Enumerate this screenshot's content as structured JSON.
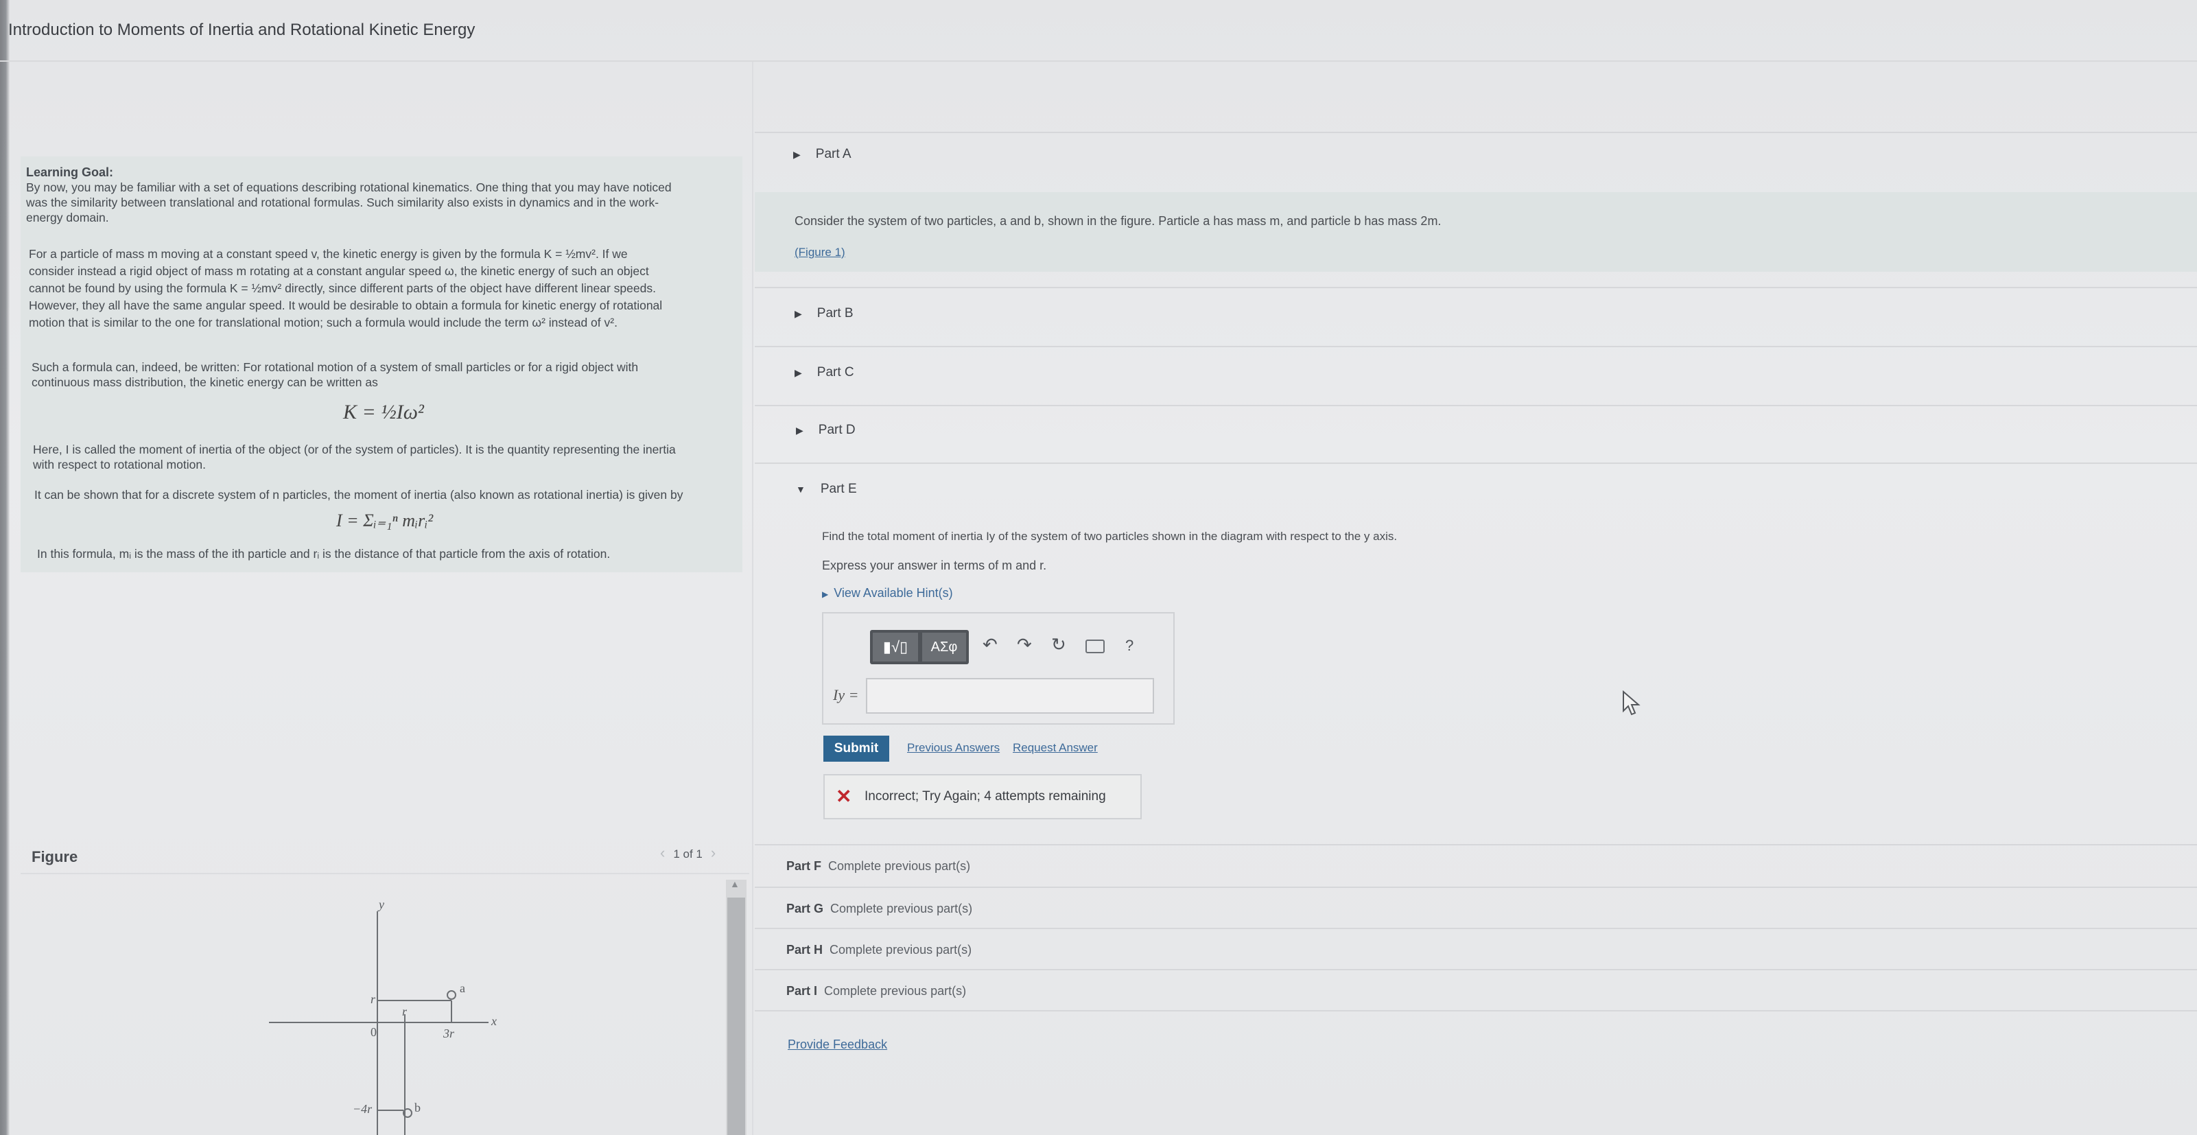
{
  "page_title": "Introduction to Moments of Inertia and Rotational Kinetic Energy",
  "learning_goal": {
    "heading": "Learning Goal:",
    "p1": [
      "By now, you may be familiar with a set of equations describing rotational kinematics. One thing that you may have noticed",
      "was the similarity between translational and rotational formulas. Such similarity also exists in dynamics and in the work-",
      "energy domain."
    ],
    "p2": [
      "For a particle of mass m moving at a constant speed v, the kinetic energy is given by the formula K = ½mv². If we",
      "consider instead a rigid object of mass m rotating at a constant angular speed ω, the kinetic energy of such an object",
      "cannot be found by using the formula K = ½mv² directly, since different parts of the object have different linear speeds.",
      "However, they all have the same angular speed. It would be desirable to obtain a formula for kinetic energy of rotational",
      "motion that is similar to the one for translational motion; such a formula would include the term ω² instead of v²."
    ],
    "p3": [
      "Such a formula can, indeed, be written: For rotational motion of a system of small particles or for a rigid object with",
      "continuous mass distribution, the kinetic energy can be written as"
    ],
    "eq1": "K = ½Iω²",
    "p4": [
      "Here, I is called the moment of inertia of the object (or of the system of particles). It is the quantity representing the inertia",
      "with respect to rotational motion."
    ],
    "p5": "It can be shown that for a discrete system of n particles, the moment of inertia (also known as rotational inertia) is given by",
    "eq2": "I = Σᵢ₌₁ⁿ mᵢrᵢ²",
    "p6": "In this formula, mᵢ is the mass of the ith particle and rᵢ is the distance of that particle from the axis of rotation."
  },
  "figure": {
    "label": "Figure",
    "pager": "1 of 1",
    "labels": {
      "y": "y",
      "x": "x",
      "r_axis": "r",
      "r_seg": "r",
      "zero": "0",
      "three_r": "3r",
      "a": "a",
      "b": "b",
      "minus_4r": "−4r"
    }
  },
  "parts": {
    "a_label": "Part A",
    "a_text": "Consider the system of two particles, a and b, shown in the figure. Particle a has mass m, and particle b has mass 2m.",
    "a_link": "(Figure 1)",
    "b_label": "Part B",
    "c_label": "Part C",
    "d_label": "Part D",
    "e_label": "Part E",
    "e_question": "Find the total moment of inertia Iy of the system of two particles shown in the diagram with respect to the y axis.",
    "e_instruction": "Express your answer in terms of m and r.",
    "e_hints": "View Available Hint(s)",
    "toolbar": {
      "templates": "▮√▯",
      "greek": "ΑΣφ",
      "help": "?"
    },
    "answer_label": "Iy =",
    "answer_value": "",
    "submit": "Submit",
    "prev_answers": "Previous Answers",
    "request_answer": "Request Answer",
    "feedback": "Incorrect; Try Again; 4 attempts remaining",
    "locked": [
      {
        "part": "Part F",
        "status": "Complete previous part(s)"
      },
      {
        "part": "Part G",
        "status": "Complete previous part(s)"
      },
      {
        "part": "Part H",
        "status": "Complete previous part(s)"
      },
      {
        "part": "Part I",
        "status": "Complete previous part(s)"
      }
    ],
    "provide_feedback": "Provide Feedback"
  },
  "colors": {
    "submit_bg": "#2d6591",
    "error": "#c0272d",
    "link": "#3d6a99"
  }
}
